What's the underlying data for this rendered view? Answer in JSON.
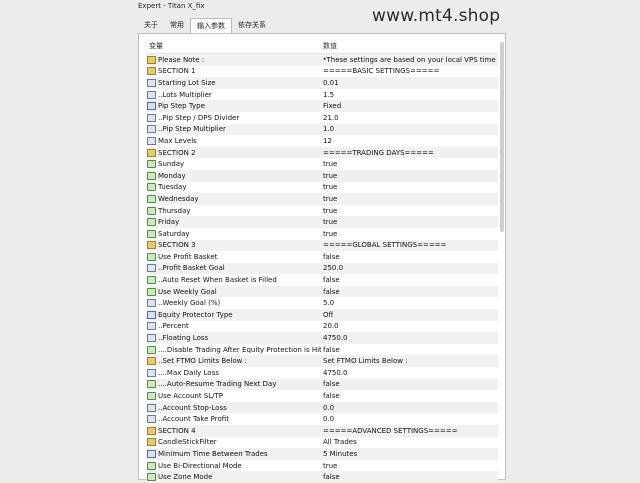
{
  "window": {
    "title": "Expert - Titan X_fix"
  },
  "tabs": [
    {
      "label": "关于"
    },
    {
      "label": "常用"
    },
    {
      "label": "输入参数"
    },
    {
      "label": "依存关系"
    }
  ],
  "watermark": "www.mt4.shop",
  "grid": {
    "headers": {
      "variable": "变量",
      "value": "数值"
    },
    "rows": [
      {
        "icon": "ab",
        "name": "Please Note :",
        "value": "*These settings are based on your local VPS time"
      },
      {
        "icon": "ab",
        "name": "SECTION 1",
        "value": "=====BASIC SETTINGS====="
      },
      {
        "icon": "num",
        "name": "Starting Lot Size",
        "value": "0.01"
      },
      {
        "icon": "num",
        "name": "..Lots Multiplier",
        "value": "1.5"
      },
      {
        "icon": "enum",
        "name": "Pip Step Type",
        "value": "Fixed"
      },
      {
        "icon": "num",
        "name": "..Pip Step / DPS Divider",
        "value": "21.0"
      },
      {
        "icon": "num",
        "name": "..Pip Step Multiplier",
        "value": "1.0"
      },
      {
        "icon": "num",
        "name": "Max Levels",
        "value": "12"
      },
      {
        "icon": "ab",
        "name": "SECTION 2",
        "value": "=====TRADING DAYS====="
      },
      {
        "icon": "bool",
        "name": "Sunday",
        "value": "true"
      },
      {
        "icon": "bool",
        "name": "Monday",
        "value": "true"
      },
      {
        "icon": "bool",
        "name": "Tuesday",
        "value": "true"
      },
      {
        "icon": "bool",
        "name": "Wednesday",
        "value": "true"
      },
      {
        "icon": "bool",
        "name": "Thursday",
        "value": "true"
      },
      {
        "icon": "bool",
        "name": "Friday",
        "value": "true"
      },
      {
        "icon": "bool",
        "name": "Saturday",
        "value": "true"
      },
      {
        "icon": "ab",
        "name": "SECTION 3",
        "value": "=====GLOBAL SETTINGS====="
      },
      {
        "icon": "bool",
        "name": "Use Profit Basket",
        "value": "false"
      },
      {
        "icon": "num",
        "name": "..Profit Basket Goal",
        "value": "250.0"
      },
      {
        "icon": "bool",
        "name": "..Auto Reset When Basket is Filled",
        "value": "false"
      },
      {
        "icon": "bool",
        "name": "Use Weekly Goal",
        "value": "false"
      },
      {
        "icon": "num",
        "name": "..Weekly Goal (%)",
        "value": "5.0"
      },
      {
        "icon": "enum",
        "name": "Equity Protector Type",
        "value": "Off"
      },
      {
        "icon": "num",
        "name": "..Percent",
        "value": "20.0"
      },
      {
        "icon": "num",
        "name": "..Floating Loss",
        "value": "4750.0"
      },
      {
        "icon": "bool",
        "name": "....Disable Trading After Equity Protection is Hit",
        "value": "false"
      },
      {
        "icon": "ab",
        "name": "..Set FTMO Limits Below :",
        "value": "Set FTMO Limits Below :"
      },
      {
        "icon": "num",
        "name": "....Max Daily Loss",
        "value": "4750.0"
      },
      {
        "icon": "bool",
        "name": "....Auto-Resume Trading Next Day",
        "value": "false"
      },
      {
        "icon": "bool",
        "name": "Use Account SL/TP",
        "value": "false"
      },
      {
        "icon": "num",
        "name": "..Account Stop-Loss",
        "value": "0.0"
      },
      {
        "icon": "num",
        "name": "..Account Take Profit",
        "value": "0.0"
      },
      {
        "icon": "ab",
        "name": "SECTION 4",
        "value": "=====ADVANCED SETTINGS====="
      },
      {
        "icon": "ab",
        "name": "CandleStickFilter",
        "value": "All Trades"
      },
      {
        "icon": "enum",
        "name": "Minimum Time Between Trades",
        "value": "5 Minutes"
      },
      {
        "icon": "bool",
        "name": "Use Bi-Directional Mode",
        "value": "true"
      },
      {
        "icon": "bool",
        "name": "Use Zone Mode",
        "value": "false"
      }
    ]
  }
}
